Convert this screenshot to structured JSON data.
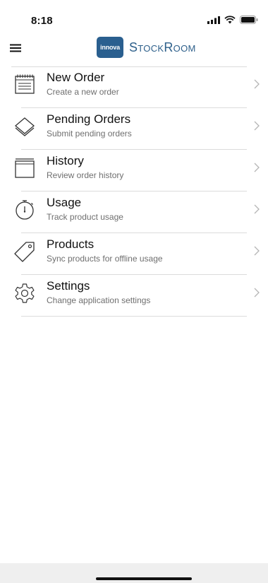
{
  "status_bar": {
    "time": "8:18"
  },
  "app": {
    "logo_text": "innova",
    "title": "StockRoom"
  },
  "menu": [
    {
      "title": "New Order",
      "subtitle": "Create a new order",
      "icon": "order-pad-icon"
    },
    {
      "title": "Pending Orders",
      "subtitle": "Submit pending orders",
      "icon": "layers-icon"
    },
    {
      "title": "History",
      "subtitle": "Review order history",
      "icon": "archive-box-icon"
    },
    {
      "title": "Usage",
      "subtitle": "Track product usage",
      "icon": "stopwatch-icon"
    },
    {
      "title": "Products",
      "subtitle": "Sync products for offline usage",
      "icon": "tag-icon"
    },
    {
      "title": "Settings",
      "subtitle": "Change application settings",
      "icon": "gear-icon"
    }
  ]
}
